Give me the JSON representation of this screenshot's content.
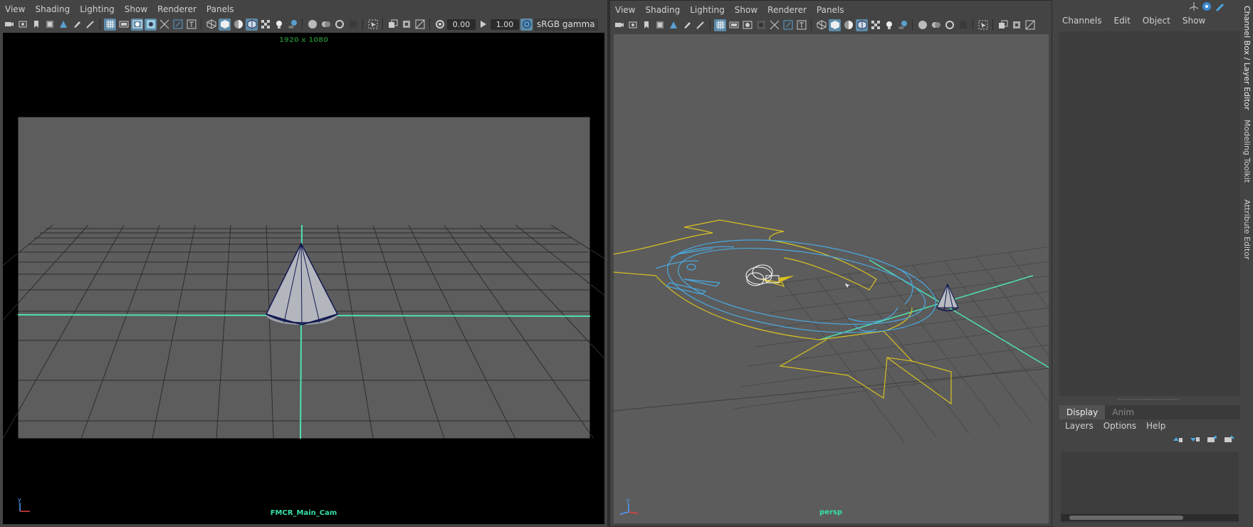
{
  "left_panel": {
    "menu": [
      "View",
      "Shading",
      "Lighting",
      "Show",
      "Renderer",
      "Panels"
    ],
    "toolbar": {
      "exposure_value": "0.00",
      "gamma_value": "1.00",
      "colorspace": "sRGB gamma"
    },
    "viewport": {
      "resolution_label": "1920 x 1080",
      "camera_name": "FMCR_Main_Cam",
      "axis_label": "y"
    }
  },
  "right_panel": {
    "menu": [
      "View",
      "Shading",
      "Lighting",
      "Show",
      "Renderer",
      "Panels"
    ],
    "viewport": {
      "camera_name": "persp",
      "axis_label": "y"
    }
  },
  "side_panel": {
    "menu": [
      "Channels",
      "Edit",
      "Object",
      "Show"
    ],
    "tabs": [
      {
        "label": "Display",
        "active": true
      },
      {
        "label": "Anim",
        "active": false
      }
    ],
    "layer_menu": [
      "Layers",
      "Options",
      "Help"
    ],
    "vertical_tabs": [
      "Channel Box / Layer Editor",
      "Modeling Toolkit",
      "Attribute Editor"
    ]
  },
  "colors": {
    "axis_green": "#4fe0b0",
    "rig_yellow": "#d8c020",
    "rig_blue": "#4aa8e0",
    "cone_outline": "#101850",
    "label_teal": "#35e0a8",
    "toolbar_active": "#5d8aa8"
  }
}
